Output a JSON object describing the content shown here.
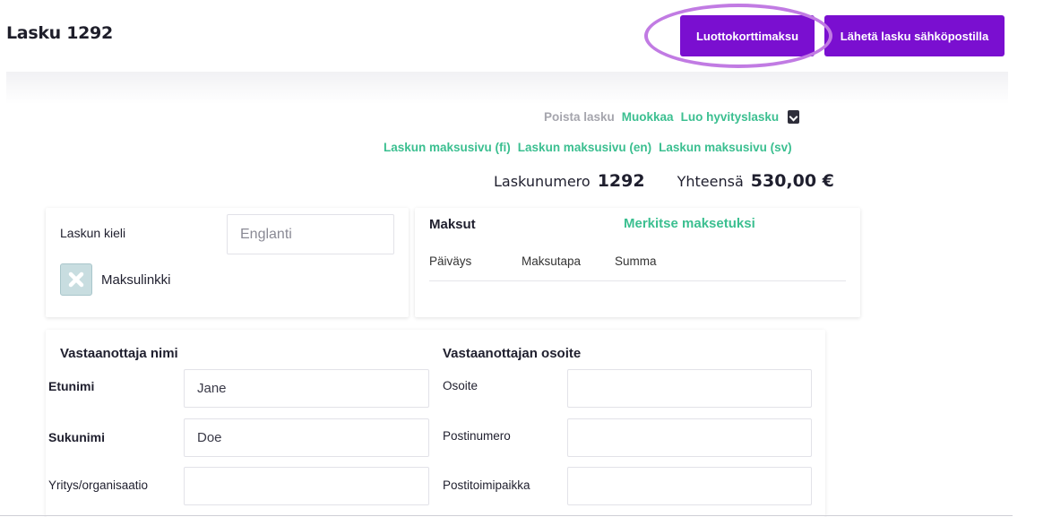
{
  "header": {
    "title": "Lasku 1292",
    "card_payment_button": "Luottokorttimaksu",
    "send_email_button": "Lähetä lasku sähköpostilla"
  },
  "actions": {
    "delete_invoice": "Poista lasku",
    "edit": "Muokkaa",
    "create_credit_note": "Luo hyvityslasku",
    "payment_page_fi": "Laskun maksusivu (fi)",
    "payment_page_en": "Laskun maksusivu (en)",
    "payment_page_sv": "Laskun maksusivu (sv)"
  },
  "summary": {
    "invoice_number_label": "Laskunumero",
    "invoice_number": "1292",
    "total_label": "Yhteensä",
    "total": "530,00 €"
  },
  "language_card": {
    "label": "Laskun kieli",
    "value": "Englanti",
    "payment_link_label": "Maksulinkki"
  },
  "payments_card": {
    "title": "Maksut",
    "mark_paid": "Merkitse maksetuksi",
    "columns": [
      "Päiväys",
      "Maksutapa",
      "Summa"
    ]
  },
  "recipient": {
    "name_title": "Vastaanottaja nimi",
    "first_name_label": "Etunimi",
    "first_name": "Jane",
    "last_name_label": "Sukunimi",
    "last_name": "Doe",
    "company_label": "Yritys/organisaatio",
    "company": "",
    "address_title": "Vastaanottajan osoite",
    "address_label": "Osoite",
    "address": "",
    "postal_code_label": "Postinumero",
    "postal_code": "",
    "city_label": "Postitoimipaikka",
    "city": ""
  },
  "colors": {
    "primary": "#7a0fd0",
    "link_green": "#3bbf90",
    "highlight": "#c17be3"
  }
}
